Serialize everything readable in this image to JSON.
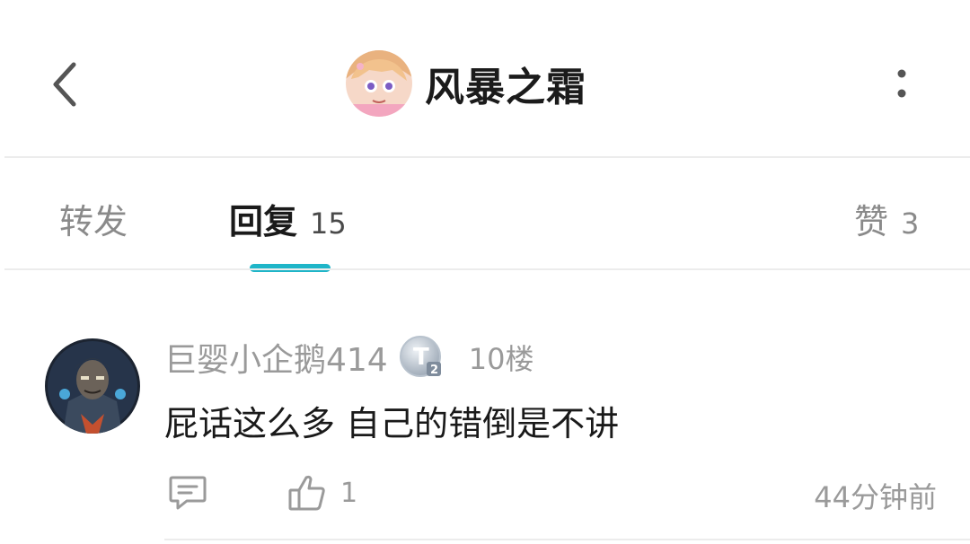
{
  "header": {
    "title": "风暴之霜",
    "back_icon": "chevron-left-icon",
    "more_icon": "more-vertical-icon"
  },
  "tabs": [
    {
      "label": "转发",
      "count": ""
    },
    {
      "label": "回复",
      "count": "15"
    },
    {
      "label": "赞",
      "count": "3"
    }
  ],
  "accent_color": "#1fb5c8",
  "comment": {
    "username": "巨婴小企鹅414",
    "badge_icon": "t2-badge-icon",
    "floor": "10楼",
    "text": "屁话这么多 自己的错倒是不讲",
    "likes": "1",
    "time": "44分钟前"
  }
}
